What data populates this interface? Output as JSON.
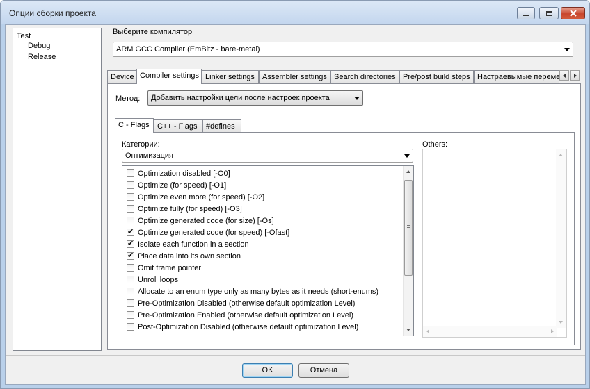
{
  "window": {
    "title": "Опции сборки проекта"
  },
  "tree": {
    "root": "Test",
    "children": [
      "Debug",
      "Release"
    ]
  },
  "compiler": {
    "label": "Выберите компилятор",
    "selected": "ARM GCC Compiler (EmBitz - bare-metal)"
  },
  "tabs": [
    {
      "label": "Device"
    },
    {
      "label": "Compiler settings"
    },
    {
      "label": "Linker settings"
    },
    {
      "label": "Assembler settings"
    },
    {
      "label": "Search directories"
    },
    {
      "label": "Pre/post build steps"
    },
    {
      "label": "Настраевымые переменные"
    }
  ],
  "method": {
    "label": "Метод:",
    "selected": "Добавить настройки цели после настроек проекта"
  },
  "subtabs": [
    {
      "label": "C - Flags"
    },
    {
      "label": "C++ - Flags"
    },
    {
      "label": "#defines"
    }
  ],
  "categories": {
    "label": "Категории:",
    "selected": "Оптимизация"
  },
  "flags": [
    {
      "label": "Optimization disabled [-O0]",
      "checked": false
    },
    {
      "label": "Optimize (for speed) [-O1]",
      "checked": false
    },
    {
      "label": "Optimize even more (for speed) [-O2]",
      "checked": false
    },
    {
      "label": "Optimize fully (for speed) [-O3]",
      "checked": false
    },
    {
      "label": "Optimize generated code (for size) [-Os]",
      "checked": false
    },
    {
      "label": "Optimize generated code (for speed) [-Ofast]",
      "checked": true
    },
    {
      "label": "Isolate each function in a section",
      "checked": true
    },
    {
      "label": "Place data into its own section",
      "checked": true
    },
    {
      "label": "Omit frame pointer",
      "checked": false
    },
    {
      "label": "Unroll loops",
      "checked": false
    },
    {
      "label": "Allocate to an enum type only as many bytes as it needs (short-enums)",
      "checked": false
    },
    {
      "label": "Pre-Optimization Disabled (otherwise default optimization Level)",
      "checked": false
    },
    {
      "label": "Pre-Optimization Enabled  (otherwise default optimization Level)",
      "checked": false
    },
    {
      "label": "Post-Optimization Disabled (otherwise default optimization Level)",
      "checked": false
    }
  ],
  "others": {
    "label": "Others:"
  },
  "buttons": {
    "ok": "OK",
    "cancel": "Отмена"
  },
  "colors": {
    "title_bar": "#c3d6ee",
    "close_button": "#c8452c",
    "default_button_border": "#3c7fb1"
  }
}
